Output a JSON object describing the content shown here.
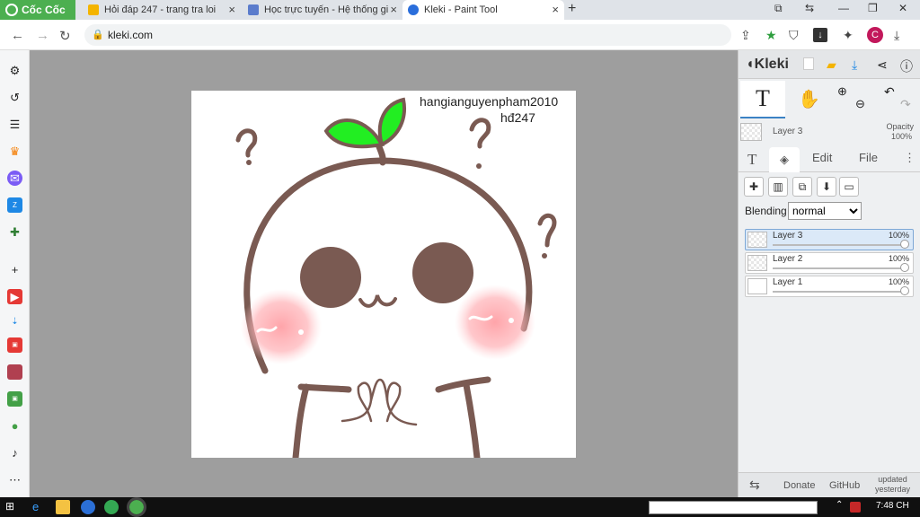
{
  "browser": {
    "brand": "Cốc Cốc",
    "tabs": [
      {
        "title": "Hỏi đáp 247 - trang tra loi",
        "color": "#f4b400"
      },
      {
        "title": "Học trực tuyến - Hệ thống gi",
        "color": "#5b7ccc"
      },
      {
        "title": "Kleki - Paint Tool",
        "color": "#2a6edb"
      }
    ],
    "url": "kleki.com",
    "avatar_letter": "C"
  },
  "kleki": {
    "brand": "Kleki",
    "active_tool": "T",
    "layer_name": "Layer 3",
    "opacity_label": "Opacity",
    "opacity_value": "100%",
    "tabs": {
      "text_icon": "T",
      "edit": "Edit",
      "file": "File"
    },
    "blending_label": "Blending",
    "blending_value": "normal",
    "blending_options": [
      "normal"
    ],
    "layers": [
      {
        "name": "Layer 3",
        "opacity": "100%",
        "selected": true
      },
      {
        "name": "Layer 2",
        "opacity": "100%",
        "selected": false
      },
      {
        "name": "Layer 1",
        "opacity": "100%",
        "selected": false
      }
    ],
    "footer": {
      "donate": "Donate",
      "github": "GitHub",
      "updated": "updated\nyesterday"
    }
  },
  "canvas": {
    "text_line1": "hangianguyenpham2010",
    "text_line2": "hđ247",
    "stroke_color": "#7a5a52",
    "leaf_color": "#22ee22",
    "blush_color": "#ff9aa0"
  },
  "taskbar": {
    "time": "7:48 CH"
  }
}
